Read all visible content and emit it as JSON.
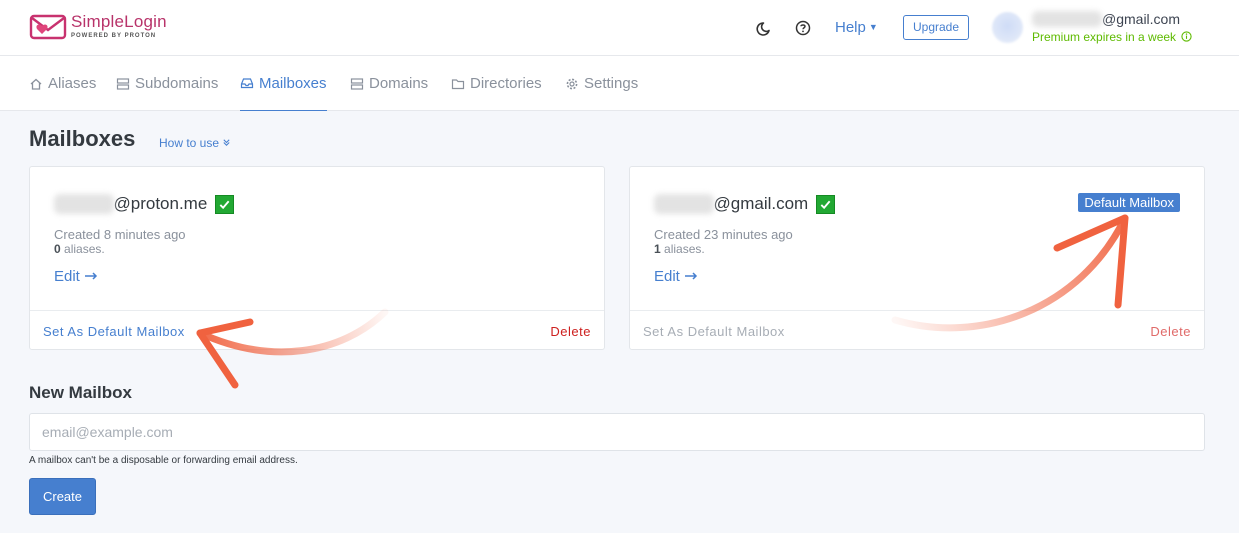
{
  "header": {
    "logo_title": "SimpleLogin",
    "logo_subtitle": "POWERED BY PROTON",
    "help_label": "Help",
    "upgrade_label": "Upgrade",
    "user_email_suffix": "@gmail.com",
    "premium_text": "Premium expires in a week"
  },
  "nav": {
    "items": [
      {
        "label": "Aliases",
        "icon": "home-icon"
      },
      {
        "label": "Subdomains",
        "icon": "server-icon"
      },
      {
        "label": "Mailboxes",
        "icon": "inbox-icon",
        "active": true
      },
      {
        "label": "Domains",
        "icon": "server-icon"
      },
      {
        "label": "Directories",
        "icon": "folder-icon"
      },
      {
        "label": "Settings",
        "icon": "gear-icon"
      }
    ]
  },
  "page": {
    "title": "Mailboxes",
    "how_to": "How to use"
  },
  "mailboxes": [
    {
      "email_suffix": "@proton.me",
      "created": "Created 8 minutes ago",
      "alias_count": "0",
      "alias_suffix": " aliases.",
      "edit_label": "Edit",
      "set_default_label": "Set As Default Mailbox",
      "delete_label": "Delete"
    },
    {
      "email_suffix": "@gmail.com",
      "badge": "Default Mailbox",
      "created": "Created 23 minutes ago",
      "alias_count": "1",
      "alias_suffix": " aliases.",
      "edit_label": "Edit",
      "set_default_label": "Set As Default Mailbox",
      "delete_label": "Delete"
    }
  ],
  "new_mailbox": {
    "title": "New Mailbox",
    "placeholder": "email@example.com",
    "hint": "A mailbox can't be a disposable or forwarding email address.",
    "create_label": "Create"
  },
  "colors": {
    "accent": "#467fcf",
    "brand": "#b8336a",
    "success": "#5eba00",
    "danger": "#cd201f",
    "annotation": "#f0623f"
  }
}
